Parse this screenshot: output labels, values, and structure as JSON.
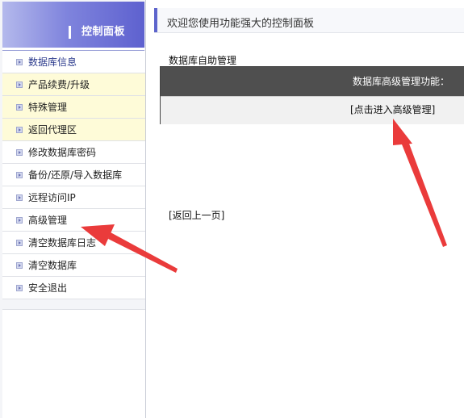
{
  "sidebar": {
    "title": "控制面板",
    "items": [
      {
        "label": "数据库信息",
        "state": "active"
      },
      {
        "label": "产品续费/升级",
        "state": "highlight"
      },
      {
        "label": "特殊管理",
        "state": "highlight"
      },
      {
        "label": "返回代理区",
        "state": "highlight"
      },
      {
        "label": "修改数据库密码",
        "state": "normal"
      },
      {
        "label": "备份/还原/导入数据库",
        "state": "normal"
      },
      {
        "label": "远程访问IP",
        "state": "normal"
      },
      {
        "label": "高级管理",
        "state": "normal"
      },
      {
        "label": "清空数据库日志",
        "state": "normal"
      },
      {
        "label": "清空数据库",
        "state": "normal"
      },
      {
        "label": "安全退出",
        "state": "normal"
      }
    ]
  },
  "main": {
    "welcome": "欢迎您使用功能强大的控制面板",
    "section_title": "数据库自助管理",
    "panel": {
      "header": "数据库高级管理功能：",
      "link": "[点击进入高级管理]"
    },
    "back_link": "[返回上一页]"
  },
  "colors": {
    "accent": "#5d64cc",
    "annotation_arrow": "#ea3b3b",
    "panel_header": "#4f4f4f",
    "highlight_row": "#fefbd8"
  }
}
